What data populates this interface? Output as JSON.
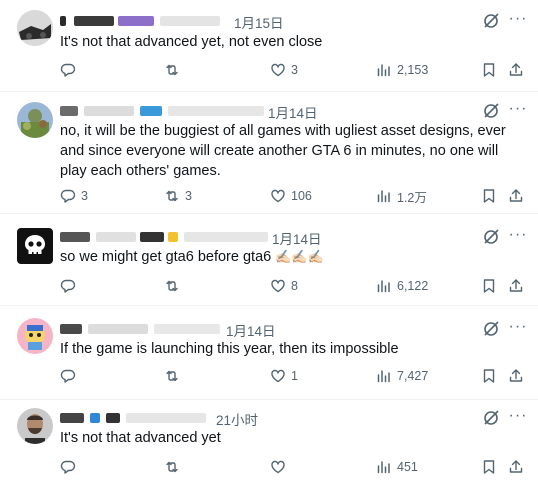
{
  "replies": [
    {
      "timestamp": "1月15日",
      "text": "It's not that advanced yet, not even close",
      "reply_count": "",
      "repost_count": "",
      "like_count": "3",
      "view_count": "2,153"
    },
    {
      "timestamp": "1月14日",
      "text": "no, it will be the buggiest of all games with ugliest asset designs, ever and since everyone will create another GTA 6 in minutes, no one will play each others' games.",
      "reply_count": "3",
      "repost_count": "3",
      "like_count": "106",
      "view_count": "1.2万"
    },
    {
      "timestamp": "1月14日",
      "text": "so we might get gta6 before gta6",
      "text_emoji": "✍🏻✍🏻✍🏻",
      "reply_count": "",
      "repost_count": "",
      "like_count": "8",
      "view_count": "6,122"
    },
    {
      "timestamp": "1月14日",
      "text": "If the game is launching this year, then its impossible",
      "reply_count": "",
      "repost_count": "",
      "like_count": "1",
      "view_count": "7,427"
    },
    {
      "timestamp": "21小时",
      "text": "It's not that advanced yet",
      "reply_count": "",
      "repost_count": "",
      "like_count": "",
      "view_count": "451"
    }
  ],
  "icons": {
    "reply": "comment-icon",
    "repost": "repost-icon",
    "like": "heart-icon",
    "views": "views-icon",
    "bookmark": "bookmark-icon",
    "share": "share-icon",
    "grok": "grok-icon",
    "more": "more-icon"
  },
  "colors": {
    "text": "#0f1419",
    "secondary": "#536471",
    "divider": "#eff3f4"
  }
}
